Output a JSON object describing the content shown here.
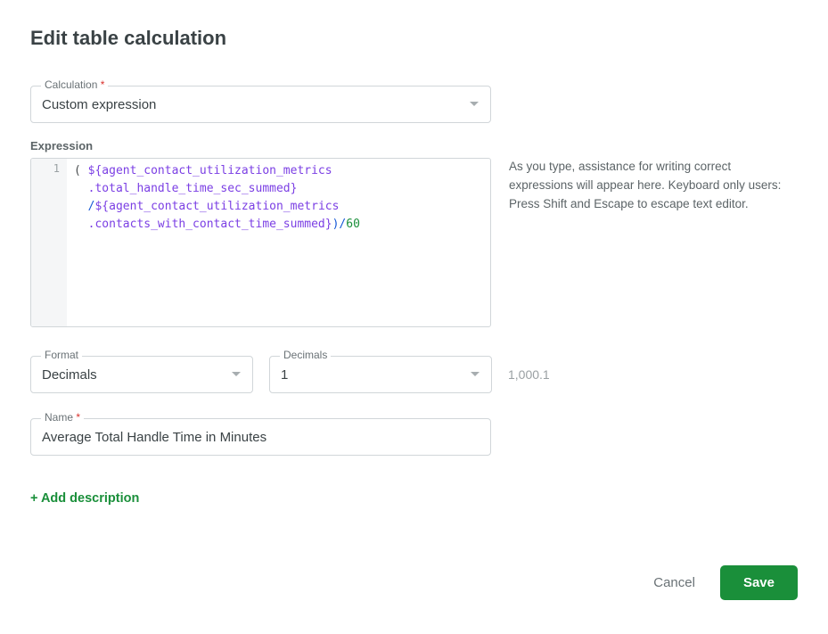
{
  "title": "Edit table calculation",
  "calculation": {
    "label": "Calculation",
    "required_marker": "*",
    "value": "Custom expression"
  },
  "expression": {
    "label": "Expression",
    "gutter": [
      "1"
    ],
    "tokens": {
      "open_paren": "(",
      "var1_line1": "${agent_contact_utilization_metrics",
      "var1_line2": ".total_handle_time_sec_summed}",
      "divide": "/",
      "var2_line1": "${agent_contact_utilization_metrics",
      "var2_line2": ".contacts_with_contact_time_summed}",
      "close_paren": ")",
      "divide2": "/",
      "literal": "60"
    },
    "helper": "As you type, assistance for writing correct expressions will appear here. Keyboard only users: Press Shift and Escape to escape text editor."
  },
  "format": {
    "label": "Format",
    "value": "Decimals"
  },
  "decimals": {
    "label": "Decimals",
    "value": "1"
  },
  "sample_output": "1,000.1",
  "name": {
    "label": "Name",
    "required_marker": "*",
    "value": "Average Total Handle Time in Minutes"
  },
  "add_description_label": "+ Add description",
  "footer": {
    "cancel": "Cancel",
    "save": "Save"
  }
}
